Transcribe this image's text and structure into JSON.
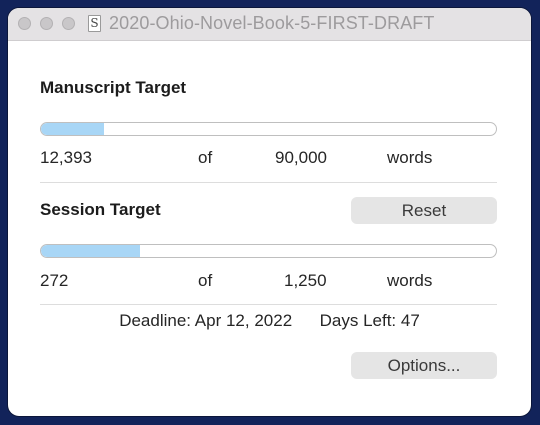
{
  "window": {
    "title": "2020-Ohio-Novel-Book-5-FIRST-DRAFT",
    "doc_icon_glyph": "S"
  },
  "manuscript": {
    "heading": "Manuscript Target",
    "current": "12,393",
    "of_label": "of",
    "target": "90,000",
    "unit": "words",
    "progress_fraction": 0.1377
  },
  "session": {
    "heading": "Session Target",
    "reset_label": "Reset",
    "current": "272",
    "of_label": "of",
    "target": "1,250",
    "unit": "words",
    "progress_fraction": 0.2176
  },
  "footer": {
    "deadline_text": "Deadline: Apr 12, 2022",
    "days_left_text": "Days Left: 47",
    "options_label": "Options..."
  },
  "colors": {
    "progress_fill": "#a8d6f6",
    "background": "#12235a"
  }
}
